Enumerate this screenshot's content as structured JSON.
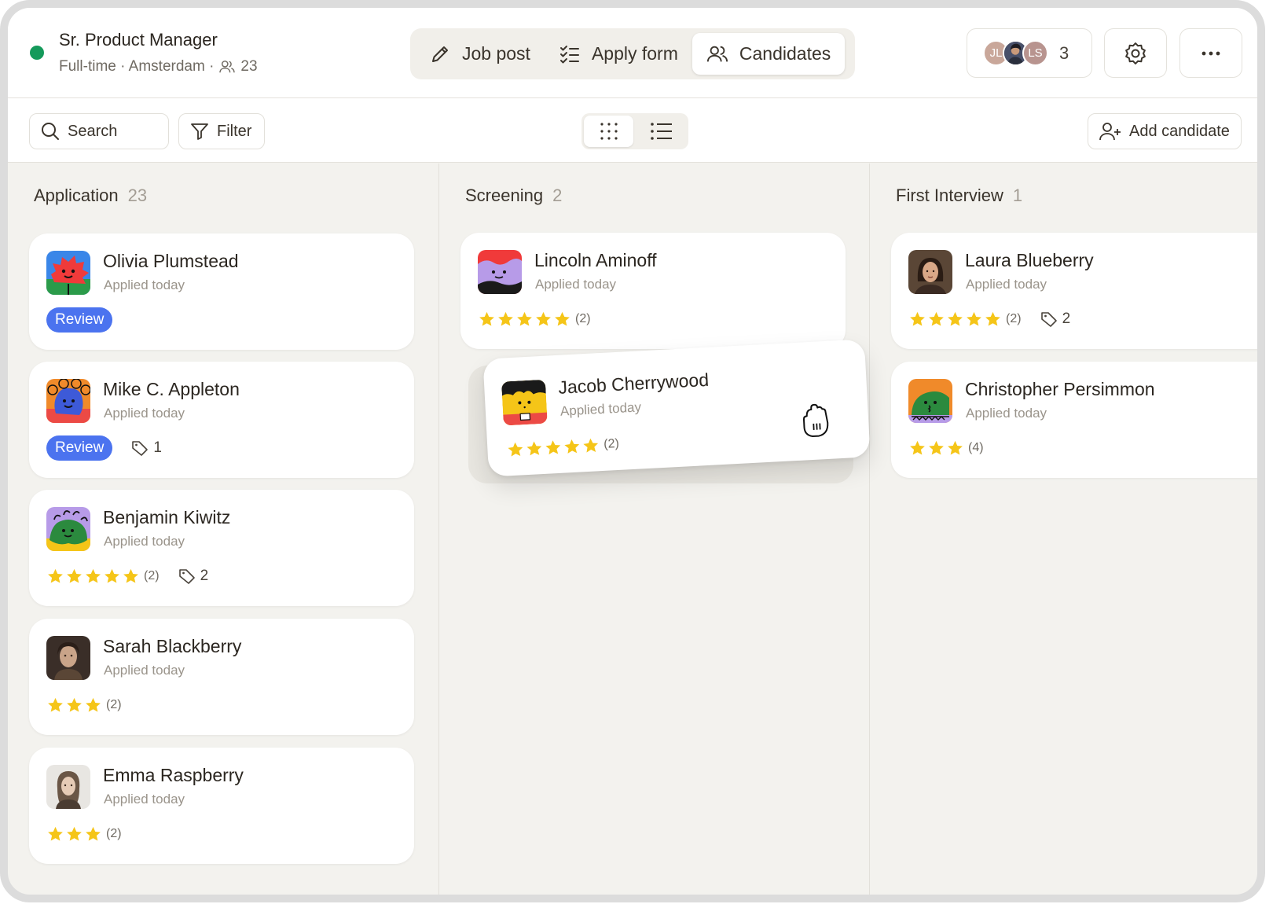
{
  "job": {
    "title": "Sr. Product Manager",
    "meta": "Full-time · Amsterdam ·",
    "candidate_count": "23",
    "status_color": "#159a5b"
  },
  "tabs": [
    {
      "label": "Job post",
      "icon": "pencil-icon"
    },
    {
      "label": "Apply form",
      "icon": "checklist-icon"
    },
    {
      "label": "Candidates",
      "icon": "users-icon",
      "active": true
    }
  ],
  "team": {
    "avatars": [
      {
        "initials": "JL",
        "color": "#c9a79a"
      },
      {
        "initials": "",
        "color": "#3b3a48"
      },
      {
        "initials": "LS",
        "color": "#b8948f"
      }
    ],
    "count": "3"
  },
  "toolbar": {
    "search_label": "Search",
    "filter_label": "Filter",
    "add_candidate_label": "Add candidate",
    "view": "board"
  },
  "columns": [
    {
      "title": "Application",
      "count": "23",
      "cards": [
        {
          "name": "Olivia Plumstead",
          "sub": "Applied today",
          "badge": "Review"
        },
        {
          "name": "Mike C. Appleton",
          "sub": "Applied today",
          "badge": "Review",
          "tags": "1"
        },
        {
          "name": "Benjamin Kiwitz",
          "sub": "Applied today",
          "stars": 5,
          "ratings": "(2)",
          "tags": "2"
        },
        {
          "name": "Sarah Blackberry",
          "sub": "Applied today",
          "stars": 3,
          "ratings": "(2)"
        },
        {
          "name": "Emma Raspberry",
          "sub": "Applied today",
          "stars": 3,
          "ratings": "(2)"
        }
      ]
    },
    {
      "title": "Screening",
      "count": "2",
      "cards": [
        {
          "name": "Lincoln Aminoff",
          "sub": "Applied today",
          "stars": 5,
          "ratings": "(2)"
        },
        {
          "name": "Jacob Cherrywood",
          "sub": "Applied today",
          "stars": 5,
          "ratings": "(2)",
          "dragging": true
        }
      ]
    },
    {
      "title": "First Interview",
      "count": "1",
      "cards": [
        {
          "name": "Laura Blueberry",
          "sub": "Applied today",
          "stars": 5,
          "ratings": "(2)",
          "tags": "2"
        },
        {
          "name": "Christopher Persimmon",
          "sub": "Applied today",
          "stars": 3,
          "ratings": "(4)"
        }
      ]
    }
  ],
  "colors": {
    "accent": "#4b73ef",
    "star": "#f5c518",
    "board_bg": "#f3f2ee"
  }
}
